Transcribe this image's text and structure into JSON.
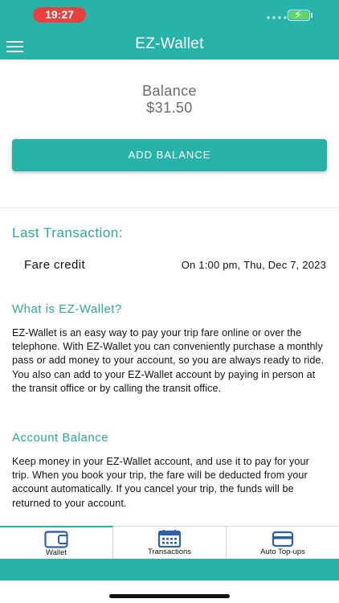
{
  "status_bar": {
    "time": "19:27",
    "icons": [
      "signal-dots-icon",
      "battery-charging-icon"
    ],
    "colors": {
      "time_pill": "#e9403f",
      "battery_fill": "#5bd96a"
    }
  },
  "header": {
    "title": "EZ-Wallet",
    "menu_icon": "hamburger-menu-icon",
    "color": "#27b3a9"
  },
  "balance": {
    "label": "Balance",
    "amount": "$31.50"
  },
  "actions": {
    "add_balance_label": "ADD BALANCE"
  },
  "last_transaction": {
    "title": "Last Transaction:",
    "name": "Fare credit",
    "date": "On 1:00 pm, Thu, Dec 7, 2023"
  },
  "info": {
    "what_title": "What is EZ-Wallet?",
    "what_text": "EZ-Wallet is an easy way to pay your trip fare online or over the telephone. With EZ-Wallet you can conveniently purchase a monthly pass or add money to your account, so you are always ready to ride. You also can add to your EZ-Wallet account by paying in person at the transit office or by calling the transit office.",
    "account_title": "Account Balance",
    "account_text": "Keep money in your EZ-Wallet account, and use it to pay for your trip. When you book your trip, the fare will be deducted from your account automatically. If you cancel your trip, the funds will be returned to your account."
  },
  "tabs": [
    {
      "label": "Wallet",
      "icon": "wallet-icon",
      "active": true
    },
    {
      "label": "Transactions",
      "icon": "calendar-icon",
      "active": false
    },
    {
      "label": "Auto Top-ups",
      "icon": "credit-card-icon",
      "active": false
    }
  ],
  "colors": {
    "accent": "#27b3a9",
    "section_heading": "#27a99f"
  }
}
